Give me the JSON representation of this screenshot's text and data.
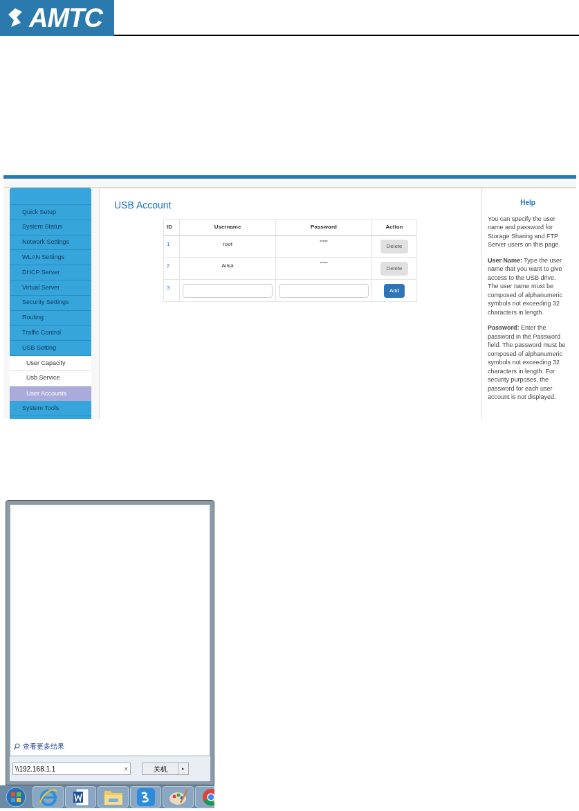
{
  "logo": {
    "text": "AMTC"
  },
  "router": {
    "sidebar": {
      "items": [
        {
          "label": "Quick Setup",
          "kind": "main",
          "selected": false
        },
        {
          "label": "System Status",
          "kind": "main",
          "selected": false
        },
        {
          "label": "Network Settings",
          "kind": "main",
          "selected": false
        },
        {
          "label": "WLAN Settings",
          "kind": "main",
          "selected": false
        },
        {
          "label": "DHCP Server",
          "kind": "main",
          "selected": false
        },
        {
          "label": "Virtual Server",
          "kind": "main",
          "selected": false
        },
        {
          "label": "Security Settings",
          "kind": "main",
          "selected": false
        },
        {
          "label": "Routing",
          "kind": "main",
          "selected": false
        },
        {
          "label": "Traffic Control",
          "kind": "main",
          "selected": false
        },
        {
          "label": "USB Setting",
          "kind": "main",
          "selected": false
        },
        {
          "label": "User Capacity",
          "kind": "sub",
          "selected": false
        },
        {
          "label": "Usb Service",
          "kind": "sub",
          "selected": false
        },
        {
          "label": "User Accounts",
          "kind": "sub",
          "selected": true
        },
        {
          "label": "System Tools",
          "kind": "main",
          "selected": false
        }
      ]
    },
    "title": "USB Account",
    "table": {
      "columns": [
        "ID",
        "Username",
        "Password",
        "Action"
      ],
      "rows": [
        {
          "id": "1",
          "username": "root",
          "password": "*****",
          "action": {
            "label": "Delete",
            "kind": "delete"
          }
        },
        {
          "id": "2",
          "username": "Alisa",
          "password": "*****",
          "action": {
            "label": "Delete",
            "kind": "delete"
          }
        },
        {
          "id": "3",
          "kind": "new",
          "action": {
            "label": "Add",
            "kind": "add"
          }
        }
      ]
    },
    "help": {
      "title": "Help",
      "paragraphs": [
        "You can specify the user name and password for Storage Sharing and FTP Server users on this page.",
        "**User Name:** Type the user name that you want to give access to the USB drive. The user name must be composed of alphanumeric symbols not exceeding 32 characters in length.",
        "**Password:** Enter the password in the Password field. The password must be composed of alphanumeric symbols not exceeding 32 characters in length. For security purposes, the password for each user account is not displayed."
      ]
    }
  },
  "start_menu": {
    "more_results": "查看更多结果",
    "search": {
      "value": "\\\\192.168.1.1",
      "clear": "×"
    },
    "shutdown": {
      "label": "关机",
      "arrow": "▸"
    }
  },
  "taskbar": {
    "items": [
      {
        "kind": "start"
      },
      {
        "kind": "ie"
      },
      {
        "kind": "word"
      },
      {
        "kind": "folder"
      },
      {
        "kind": "sogou"
      },
      {
        "kind": "paint"
      },
      {
        "kind": "chrome"
      }
    ]
  }
}
